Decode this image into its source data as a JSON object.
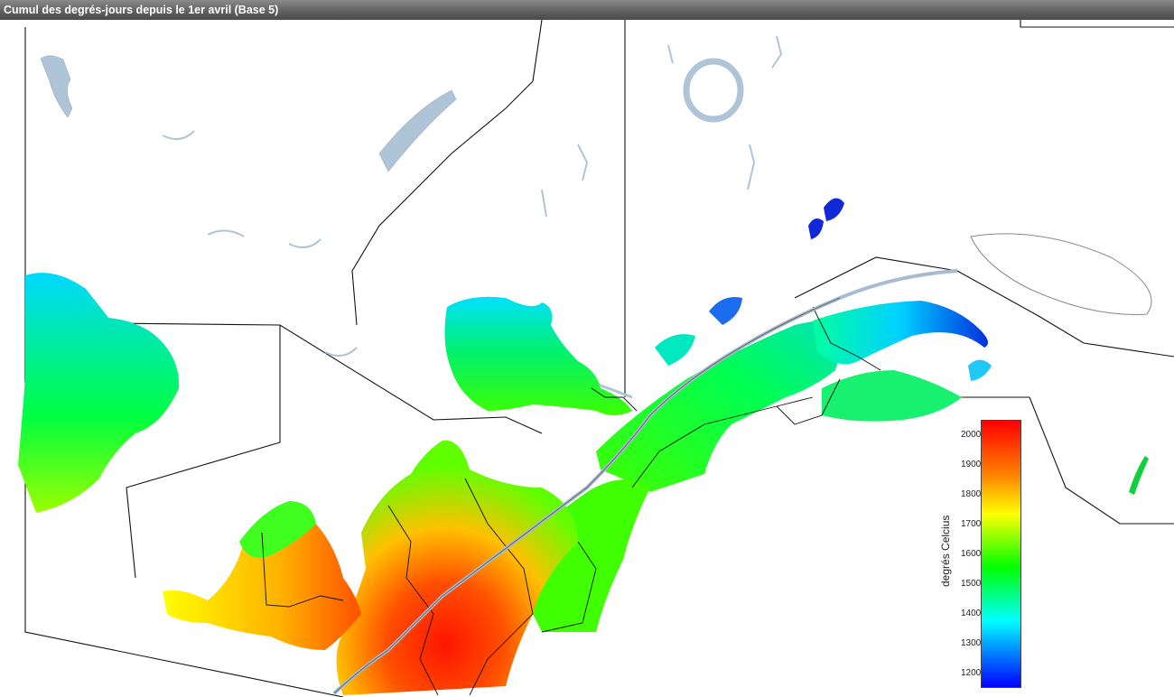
{
  "window": {
    "title": "Cumul des degrés-jours depuis le 1er avril (Base 5)"
  },
  "legend": {
    "label": "degrés Celcius",
    "ticks": [
      "2000",
      "1900",
      "1800",
      "1700",
      "1600",
      "1500",
      "1400",
      "1300",
      "1200"
    ],
    "range": [
      1150,
      2050
    ],
    "colors": [
      "#ff0000",
      "#ff8000",
      "#ffff00",
      "#00ff00",
      "#00ffff",
      "#0000ff"
    ]
  },
  "map": {
    "boundary_color": "#111111",
    "water_color": "#b0c4d8"
  }
}
